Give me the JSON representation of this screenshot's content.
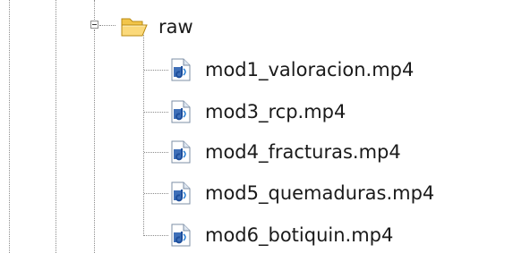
{
  "tree": {
    "folder": {
      "label": "raw",
      "icon": "open-folder-icon",
      "expanded": true
    },
    "files": [
      {
        "label": "mod1_valoracion.mp4",
        "icon": "media-file-icon"
      },
      {
        "label": "mod3_rcp.mp4",
        "icon": "media-file-icon"
      },
      {
        "label": "mod4_fracturas.mp4",
        "icon": "media-file-icon"
      },
      {
        "label": "mod5_quemaduras.mp4",
        "icon": "media-file-icon"
      },
      {
        "label": "mod6_botiquin.mp4",
        "icon": "media-file-icon"
      }
    ]
  }
}
